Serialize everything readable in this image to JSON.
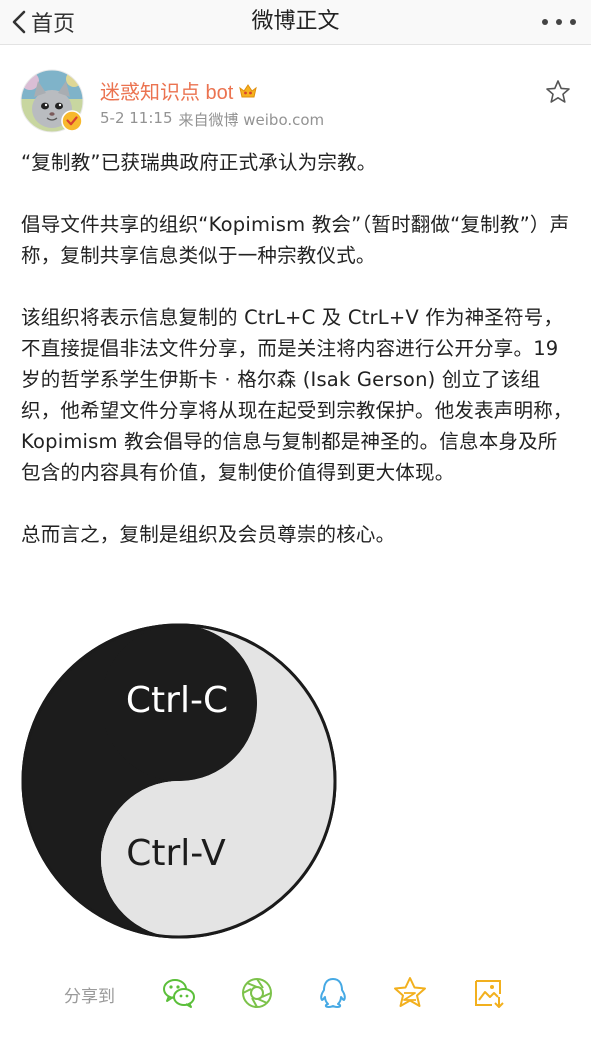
{
  "nav": {
    "back_label": "首页",
    "title": "微博正文",
    "more_label": "•••"
  },
  "author": {
    "name": "迷惑知识点 bot",
    "time": "5-2 11:15",
    "source": "来自微博 weibo.com"
  },
  "post": {
    "paragraphs": [
      "“复制教”已获瑞典政府正式承认为宗教。",
      "倡导文件共享的组织“Kopimism 教会”（暂时翻做“复制教”）声称，复制共享信息类似于一种宗教仪式。",
      "该组织将表示信息复制的 CtrL+C 及 CtrL+V 作为神圣符号，不直接提倡非法文件分享，而是关注将内容进行公开分享。19 岁的哲学系学生伊斯卡 · 格尔森 (Isak Gerson) 创立了该组织，他希望文件分享将从现在起受到宗教保护。他发表声明称，Kopimism 教会倡导的信息与复制都是神圣的。信息本身及所包含的内容具有价值，复制使价值得到更大体现。",
      "总而言之，复制是组织及会员尊崇的核心。"
    ]
  },
  "image": {
    "top_text": "Ctrl-C",
    "bottom_text": "Ctrl-V"
  },
  "share": {
    "label": "分享到",
    "icons": [
      "wechat-icon",
      "moments-icon",
      "qq-icon",
      "qzone-icon",
      "save-image-icon"
    ]
  },
  "colors": {
    "username": "#eb7350",
    "meta": "#939393",
    "share_green": "#5bbf3a",
    "share_blue": "#46a9e4",
    "share_gold": "#f2b01e"
  }
}
